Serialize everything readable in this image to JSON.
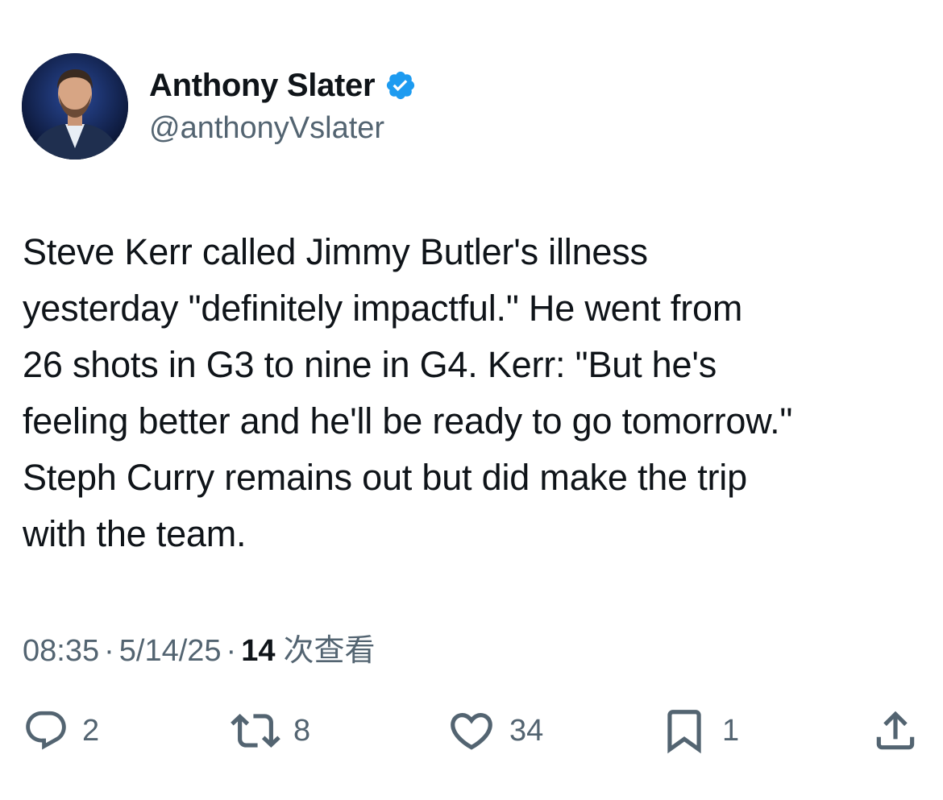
{
  "author": {
    "display_name": "Anthony Slater",
    "handle": "@anthonyVslater",
    "verified": true,
    "verified_color": "#1d9bf0"
  },
  "tweet": {
    "text_lines": [
      "Steve Kerr called Jimmy Butler's illness",
      "yesterday \"definitely impactful.\" He went from",
      "26 shots in G3 to nine in G4. Kerr: \"But he's",
      "feeling better and he'll be ready to go tomorrow.\"",
      "Steph Curry remains out but did make the trip",
      "with the team."
    ]
  },
  "meta": {
    "time": "08:35",
    "separator": "·",
    "date": "5/14/25",
    "views_count": "14",
    "views_label": "次查看"
  },
  "actions": {
    "reply": {
      "icon": "reply-icon",
      "count": "2"
    },
    "retweet": {
      "icon": "retweet-icon",
      "count": "8"
    },
    "like": {
      "icon": "heart-icon",
      "count": "34"
    },
    "bookmark": {
      "icon": "bookmark-icon",
      "count": "1"
    },
    "share": {
      "icon": "share-icon"
    }
  },
  "colors": {
    "text_primary": "#0f1419",
    "text_secondary": "#536471",
    "icon": "#536471"
  }
}
